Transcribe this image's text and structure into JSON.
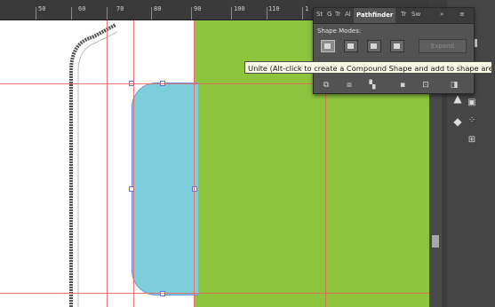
{
  "ruler": {
    "marks": [
      "50",
      "60",
      "70",
      "80",
      "90",
      "100",
      "110",
      "1"
    ]
  },
  "pathfinder": {
    "tabs": [
      "St",
      "G",
      "Tr",
      "Al",
      "Pathfinder",
      "Tr",
      "Sw"
    ],
    "active_tab": "Pathfinder",
    "menu_glyph": "»",
    "options_glyph": "≡",
    "shape_modes_label": "Shape Modes:",
    "expand_label": "Expand",
    "pathfinders_icons": [
      "divide-icon",
      "trim-icon",
      "merge-icon",
      "crop-icon",
      "outline-icon",
      "minus-back-icon"
    ]
  },
  "tooltip": {
    "text": "Unite (Alt-click to create a Compound Shape and add to shape area)"
  },
  "colors": {
    "ruler_bg": "#3a3a3a",
    "green_rect": "#8cc43d",
    "blue_shape": "#7ccfd8",
    "guides": "#e8635e",
    "panel_bg": "#535353",
    "tooltip_bg": "#fbfbe8"
  }
}
